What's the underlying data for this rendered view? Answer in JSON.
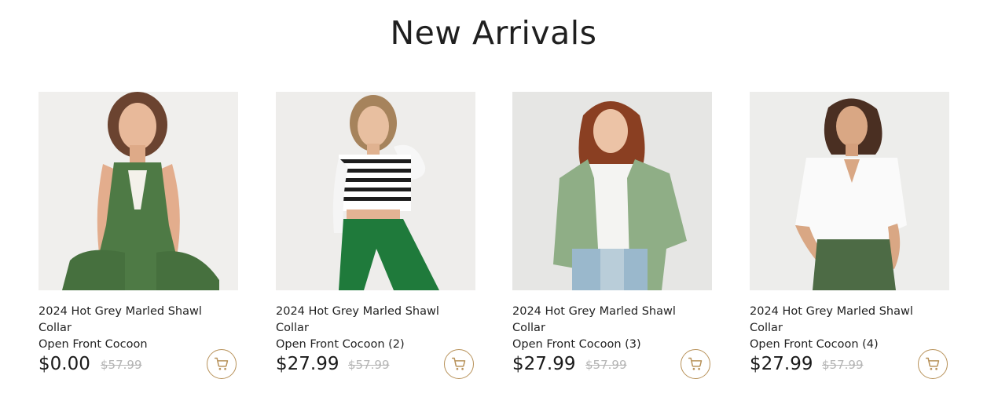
{
  "section": {
    "title": "New Arrivals"
  },
  "products": [
    {
      "name_line1": "2024 Hot Grey Marled Shawl Collar",
      "name_line2": "Open Front Cocoon",
      "price": "$0.00",
      "old_price": "$57.99",
      "image": "woman-green-jumpsuit-photo"
    },
    {
      "name_line1": "2024 Hot Grey Marled Shawl Collar",
      "name_line2": "Open Front Cocoon (2)",
      "price": "$27.99",
      "old_price": "$57.99",
      "image": "woman-striped-top-green-pants-photo"
    },
    {
      "name_line1": "2024 Hot Grey Marled Shawl Collar",
      "name_line2": "Open Front Cocoon (3)",
      "price": "$27.99",
      "old_price": "$57.99",
      "image": "woman-sage-jacket-jeans-photo"
    },
    {
      "name_line1": "2024 Hot Grey Marled Shawl Collar",
      "name_line2": "Open Front Cocoon (4)",
      "price": "$27.99",
      "old_price": "$57.99",
      "image": "woman-white-blouse-green-pants-photo"
    }
  ],
  "colors": {
    "accent": "#b8925a",
    "old_price": "#b5b5b5",
    "text": "#222222"
  },
  "icons": {
    "cart": "shopping-cart-icon"
  }
}
